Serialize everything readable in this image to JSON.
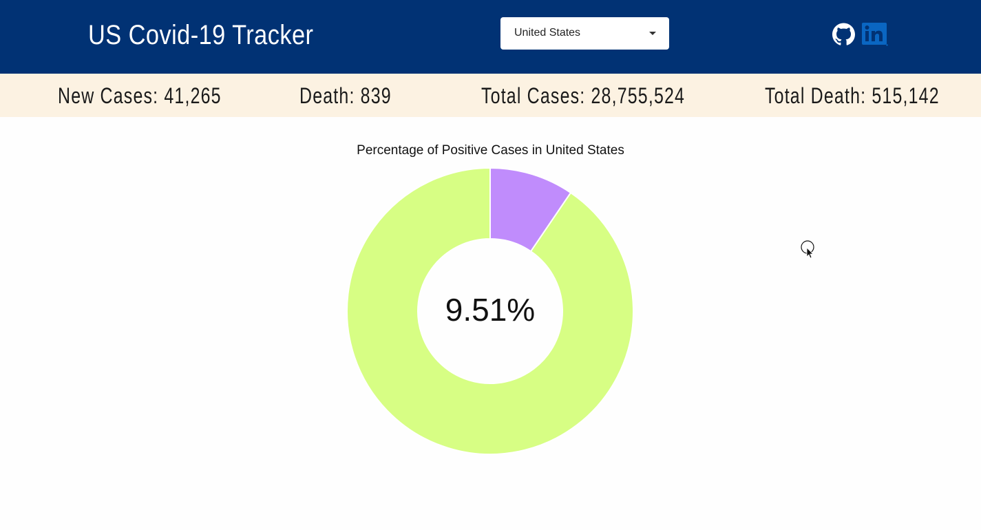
{
  "header": {
    "title": "US Covid-19 Tracker",
    "country_select": {
      "value": "United States"
    },
    "github_icon": "github-icon",
    "linkedin_icon": "linkedin-icon",
    "colors": {
      "background": "#013274",
      "text": "#ffffff"
    }
  },
  "stats": {
    "new_cases": "New Cases: 41,265",
    "death": "Death: 839",
    "total_cases": "Total Cases: 28,755,524",
    "total_death": "Total Death: 515,142",
    "background": "#fcf2e2"
  },
  "chart_data": {
    "type": "pie",
    "title": "Percentage of Positive Cases in United States",
    "center_label": "9.51%",
    "slices": [
      {
        "value": 9.51,
        "color": "#c08cfc"
      },
      {
        "value": 90.49,
        "color": "#d7fe84"
      }
    ]
  }
}
